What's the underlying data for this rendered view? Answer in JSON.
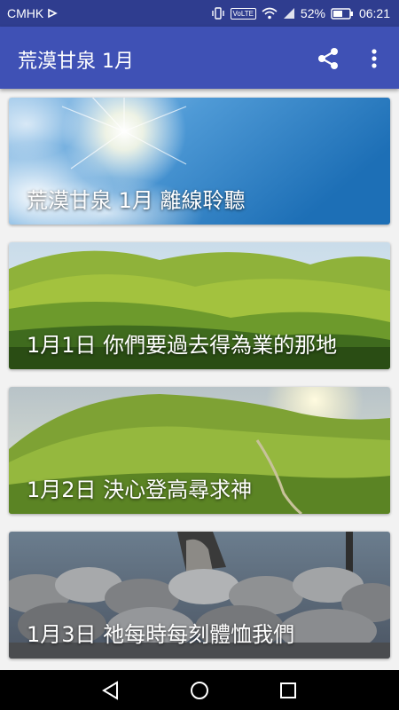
{
  "status_bar": {
    "carrier": "CMHK",
    "volte": "VoLTE",
    "battery": "52%",
    "time": "06:21"
  },
  "app_bar": {
    "title": "荒漠甘泉 1月",
    "share_icon": "share-icon",
    "more_icon": "more-vert-icon"
  },
  "cards": [
    {
      "title": "荒漠甘泉 1月 離線聆聽",
      "image": "blue sky with sun and clouds"
    },
    {
      "title": "1月1日 你們要過去得為業的那地",
      "image": "green rolling hills"
    },
    {
      "title": "1月2日 決心登高尋求神",
      "image": "grassy hill with sunlight"
    },
    {
      "title": "1月3日 祂每時每刻體恤我們",
      "image": "shepherd with flock of sheep"
    }
  ],
  "nav_bar": {
    "back_icon": "back-triangle-icon",
    "home_icon": "home-circle-icon",
    "recents_icon": "recents-square-icon"
  }
}
